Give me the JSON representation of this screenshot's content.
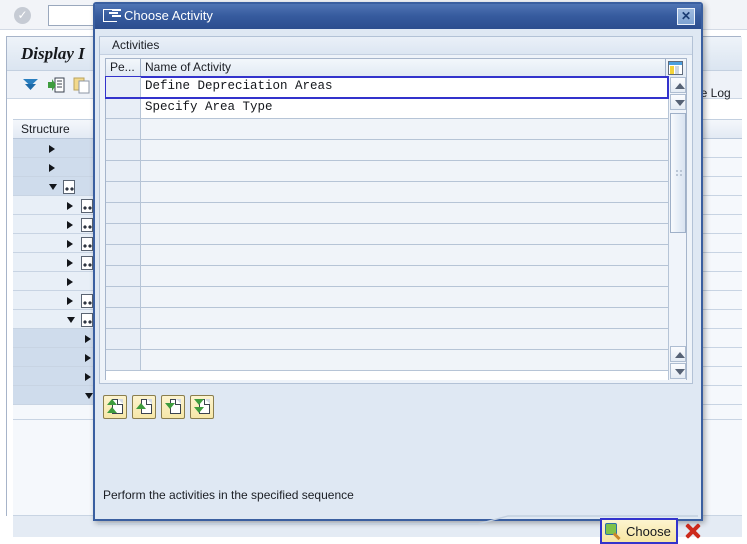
{
  "background": {
    "command_field_value": "",
    "ok_icon": "check-circle-icon",
    "app_title": "Display I",
    "toolbar_icons": [
      "filter-icon",
      "expand-node-icon",
      "copy-icon"
    ],
    "change_log_label": "ge Log",
    "tree_column_header": "Structure",
    "tree_rows": [
      {
        "indent": 36,
        "arrow": "right",
        "doc": false
      },
      {
        "indent": 36,
        "arrow": "right",
        "doc": false
      },
      {
        "indent": 36,
        "arrow": "down",
        "doc": true
      },
      {
        "indent": 54,
        "arrow": "right",
        "doc": true
      },
      {
        "indent": 54,
        "arrow": "right",
        "doc": true
      },
      {
        "indent": 54,
        "arrow": "right",
        "doc": true
      },
      {
        "indent": 54,
        "arrow": "right",
        "doc": true
      },
      {
        "indent": 54,
        "arrow": "right",
        "doc": false
      },
      {
        "indent": 54,
        "arrow": "right",
        "doc": true
      },
      {
        "indent": 54,
        "arrow": "down",
        "doc": true
      },
      {
        "indent": 72,
        "arrow": "right",
        "doc": false
      },
      {
        "indent": 72,
        "arrow": "right",
        "doc": false
      },
      {
        "indent": 72,
        "arrow": "right",
        "doc": false
      },
      {
        "indent": 72,
        "arrow": "down",
        "doc": false
      }
    ]
  },
  "dialog": {
    "title": "Choose Activity",
    "title_icon": "dialog-window-icon",
    "close_label": "✕",
    "panel_title": "Activities",
    "grid": {
      "columns": [
        "Pe...",
        "Name of Activity"
      ],
      "settings_icon": "table-settings-icon",
      "rows": [
        {
          "pe": "",
          "name": "Define Depreciation Areas",
          "selected": true
        },
        {
          "pe": "",
          "name": "Specify Area Type",
          "selected": false
        }
      ],
      "empty_row_count": 12
    },
    "scrollbar": {
      "up_arrow": "scroll-up-arrow-icon",
      "down_arrow": "scroll-down-arrow-icon"
    },
    "activity_buttons": [
      {
        "name": "move-to-first-activity-button",
        "icon": "page-double-up-icon"
      },
      {
        "name": "previous-activity-button",
        "icon": "page-up-icon"
      },
      {
        "name": "next-activity-button",
        "icon": "page-down-icon"
      },
      {
        "name": "move-to-last-activity-button",
        "icon": "page-double-down-icon"
      }
    ],
    "hint": "Perform the activities in the specified sequence",
    "choose_button": {
      "label": "Choose",
      "icon": "magnifier-choose-icon"
    },
    "cancel_button": {
      "label": "",
      "icon": "red-x-cancel-icon"
    }
  },
  "colors": {
    "dialog_border": "#3a5fa0",
    "titlebar": "#365b9e",
    "selection_outline": "#3333cc",
    "button_yellow": "#f6e5a2",
    "cancel_red": "#cc2a1c"
  }
}
